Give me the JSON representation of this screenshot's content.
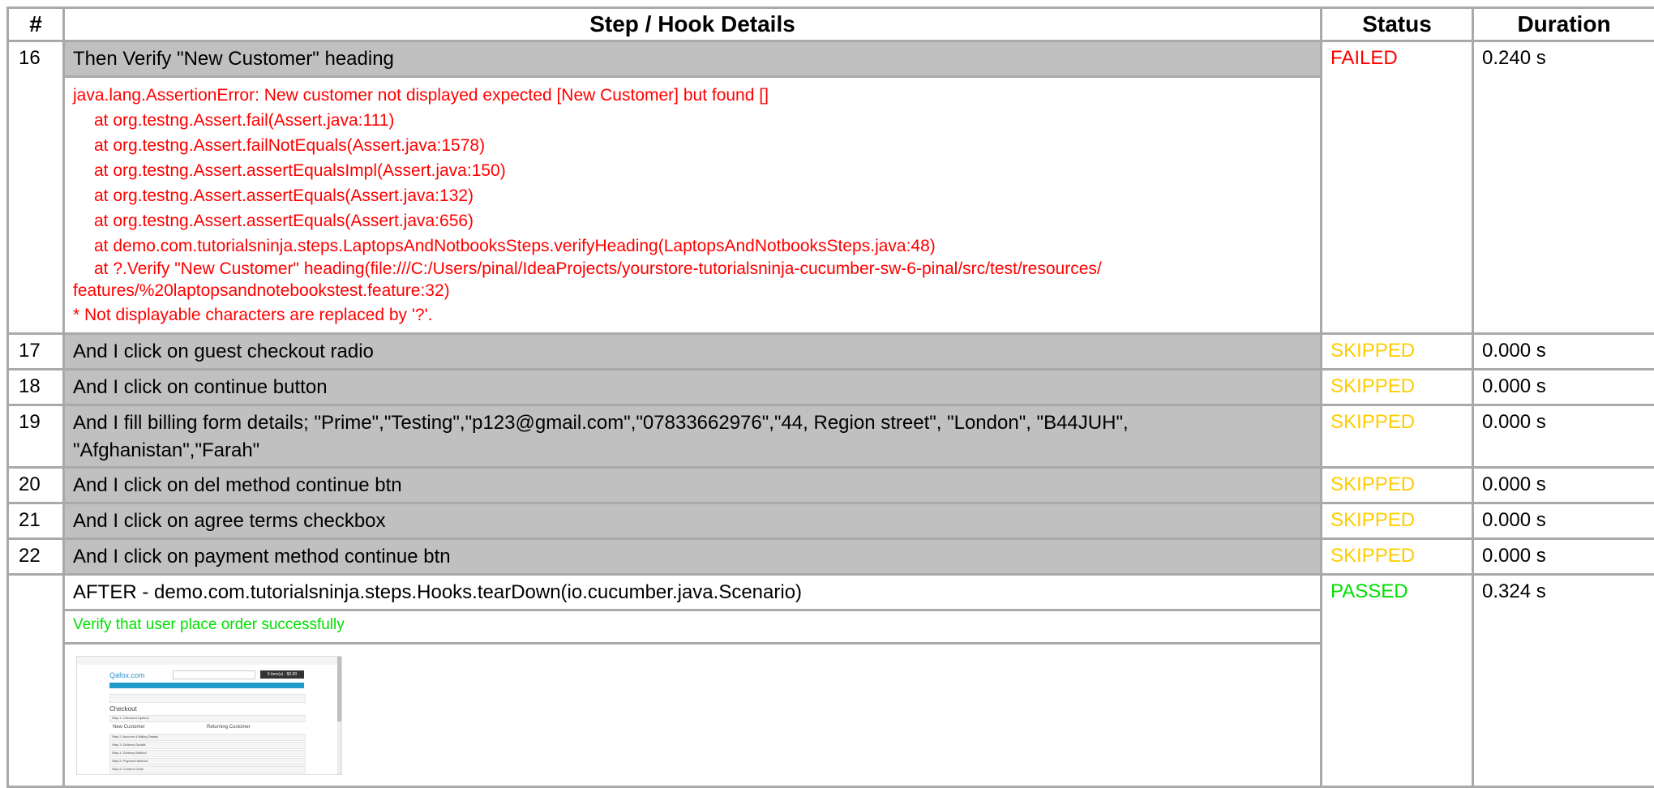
{
  "headers": {
    "num": "#",
    "details": "Step / Hook Details",
    "status": "Status",
    "duration": "Duration"
  },
  "row16": {
    "num": "16",
    "step": "Then Verify \"New Customer\" heading",
    "status": "FAILED",
    "duration": "0.240 s",
    "error": {
      "first": "java.lang.AssertionError: New customer not displayed expected [New Customer] but found []",
      "lines": [
        "at org.testng.Assert.fail(Assert.java:111)",
        "at org.testng.Assert.failNotEquals(Assert.java:1578)",
        "at org.testng.Assert.assertEqualsImpl(Assert.java:150)",
        "at org.testng.Assert.assertEquals(Assert.java:132)",
        "at org.testng.Assert.assertEquals(Assert.java:656)",
        "at demo.com.tutorialsninja.steps.LaptopsAndNotbooksSteps.verifyHeading(LaptopsAndNotbooksSteps.java:48)",
        "at ?.Verify \"New Customer\" heading(file:///C:/Users/pinal/IdeaProjects/yourstore-tutorialsninja-cucumber-sw-6-pinal/src/test/resources/"
      ],
      "wrap": "features/%20laptopsandnotebookstest.feature:32)",
      "note": "* Not displayable characters are replaced by '?'."
    }
  },
  "rows": [
    {
      "num": "17",
      "step": "And I click on guest checkout radio",
      "status": "SKIPPED",
      "duration": "0.000 s"
    },
    {
      "num": "18",
      "step": "And I click on continue button",
      "status": "SKIPPED",
      "duration": "0.000 s"
    },
    {
      "num": "19",
      "step": "And I fill billing form details; \"Prime\",\"Testing\",\"p123@gmail.com\",\"07833662976\",\"44, Region street\", \"London\", \"B44JUH\", \"Afghanistan\",\"Farah\"",
      "status": "SKIPPED",
      "duration": "0.000 s"
    },
    {
      "num": "20",
      "step": "And I click on del method continue btn",
      "status": "SKIPPED",
      "duration": "0.000 s"
    },
    {
      "num": "21",
      "step": "And I click on agree terms checkbox",
      "status": "SKIPPED",
      "duration": "0.000 s"
    },
    {
      "num": "22",
      "step": "And I click on payment method continue btn",
      "status": "SKIPPED",
      "duration": "0.000 s"
    }
  ],
  "after": {
    "num": "",
    "hook": "AFTER - demo.com.tutorialsninja.steps.Hooks.tearDown(io.cucumber.java.Scenario)",
    "status": "PASSED",
    "duration": "0.324 s",
    "message": "Verify that user place order successfully",
    "thumb": {
      "logo": "Qafox.com",
      "cart": "0 item(s) - $0.00",
      "heading": "Checkout",
      "step1": "Step 1: Checkout Options",
      "new_customer": "New Customer",
      "returning_customer": "Returning Customer",
      "step2": "Step 2: Account & Billing Details",
      "step3": "Step 3: Delivery Details",
      "step4": "Step 4: Delivery Method",
      "step5": "Step 5: Payment Method",
      "step6": "Step 6: Confirm Order"
    }
  },
  "colors": {
    "failed": "#ff0000",
    "skipped": "#ffcc00",
    "passed": "#00e000",
    "step_bg": "#c0c0c0"
  }
}
